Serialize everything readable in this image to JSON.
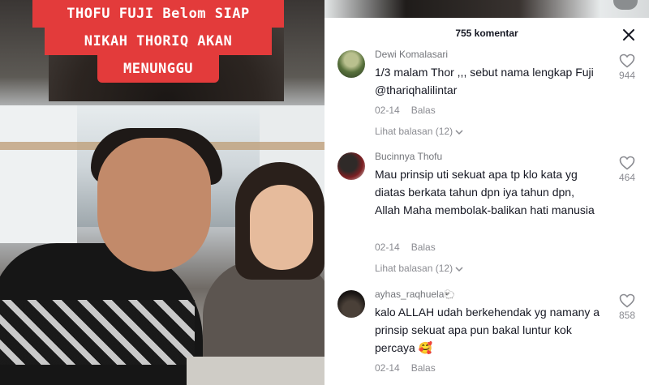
{
  "video": {
    "caption_lines": [
      "THOFU FUJI Belom SIAP",
      "NIKAH THORIQ AKAN",
      "MENUNGGU"
    ]
  },
  "panel": {
    "title": "755 komentar",
    "close_icon": "close-icon"
  },
  "comments": [
    {
      "username": "Dewi Komalasari",
      "text_line1": "1/3 malam Thor ,,, sebut nama lengkap Fuji",
      "text_line2": "@thariqhalilintar",
      "date": "02-14",
      "reply_label": "Balas",
      "view_replies": "Lihat balasan (12)",
      "likes": "944"
    },
    {
      "username": "Bucinnya Thofu",
      "text": "Mau prinsip uti sekuat apa tp klo kata yg diatas berkata tahun dpn iya tahun dpn, Allah Maha membolak-balikan hati manusia",
      "date": "02-14",
      "reply_label": "Balas",
      "view_replies": "Lihat balasan (12)",
      "likes": "464"
    },
    {
      "username": "ayhas_raqhuela",
      "username_emoji": "🐑",
      "text": "kalo ALLAH udah berkehendak yg namany a prinsip sekuat apa pun bakal luntur kok percaya 🥰",
      "date": "02-14",
      "reply_label": "Balas",
      "likes": "858"
    }
  ],
  "colors": {
    "caption_bg": "#e33b3b",
    "text_primary": "#161823",
    "text_secondary": "#8a8b91"
  }
}
